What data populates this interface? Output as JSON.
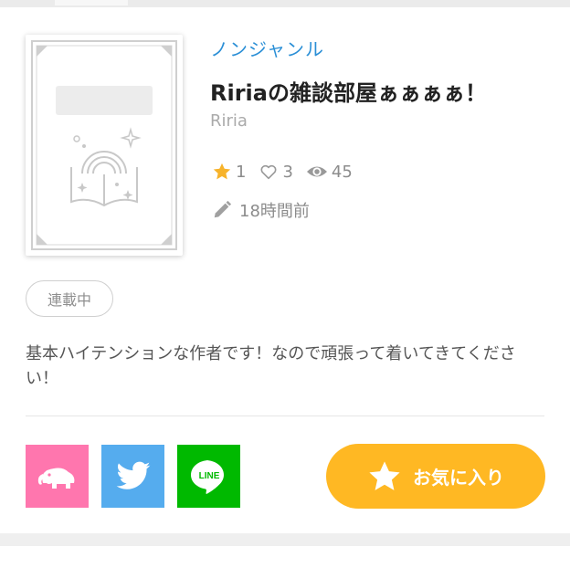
{
  "novel": {
    "genre": "ノンジャンル",
    "title": "Ririaの雑談部屋ぁぁぁぁ！",
    "author": "Riria",
    "status": "連載中",
    "description": "基本ハイテンションな作者です！なので頑張って着いてきてください！"
  },
  "stats": {
    "stars": "1",
    "likes": "3",
    "views": "45",
    "updated": "18時間前"
  },
  "share": {
    "line_label": "LINE"
  },
  "favorite": {
    "label": "お気に入り"
  },
  "colors": {
    "genre": "#2b8fd6",
    "star": "#f7b32b",
    "favorite_button": "#ffb823",
    "hatena": "#ff76ae",
    "twitter": "#55acee",
    "line": "#00b900"
  },
  "icons": [
    "book-cover-placeholder-icon",
    "star-icon",
    "heart-icon",
    "eye-icon",
    "pencil-icon",
    "hatena-elephant-icon",
    "twitter-bird-icon",
    "line-icon"
  ]
}
